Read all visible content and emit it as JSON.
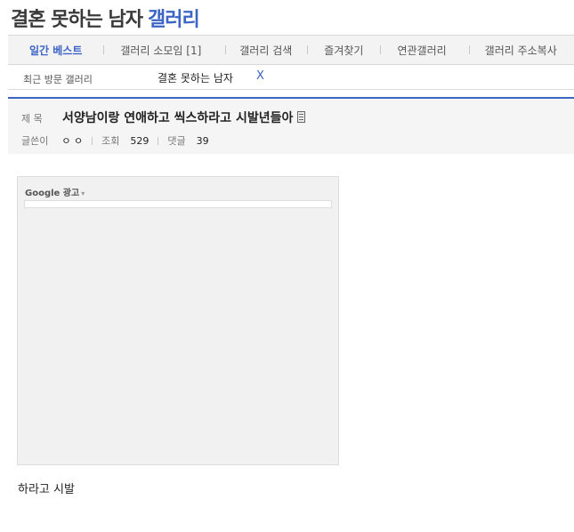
{
  "header": {
    "title_main": "결혼 못하는 남자",
    "title_suffix": "갤러리"
  },
  "nav": {
    "items": [
      {
        "label": "일간 베스트",
        "active": true
      },
      {
        "label": "갤러리 소모임 [1]"
      },
      {
        "label": "갤러리 검색"
      },
      {
        "label": "즐겨찾기"
      },
      {
        "label": "연관갤러리"
      },
      {
        "label": "갤러리 주소복사"
      }
    ]
  },
  "recent": {
    "label": "최근 방문 갤러리",
    "items": [
      "결혼 못하는 남자"
    ],
    "close_glyph": "X"
  },
  "post": {
    "subject_label": "제 목",
    "subject": "서양남이랑 연애하고 씩스하라고 시발년들아",
    "author_label": "글쓴이",
    "author": "ㅇ ㅇ",
    "views_label": "조회",
    "views": "529",
    "comments_label": "댓글",
    "comments": "39",
    "body": "하라고 시발"
  },
  "ad": {
    "label": "Google 광고",
    "caret_glyph": "▾"
  },
  "colors": {
    "accent": "#3b64c5",
    "nav_bg": "#f3f3f3",
    "post_head_bg": "#f5f5f5",
    "ad_bg": "#f1f1f1"
  }
}
